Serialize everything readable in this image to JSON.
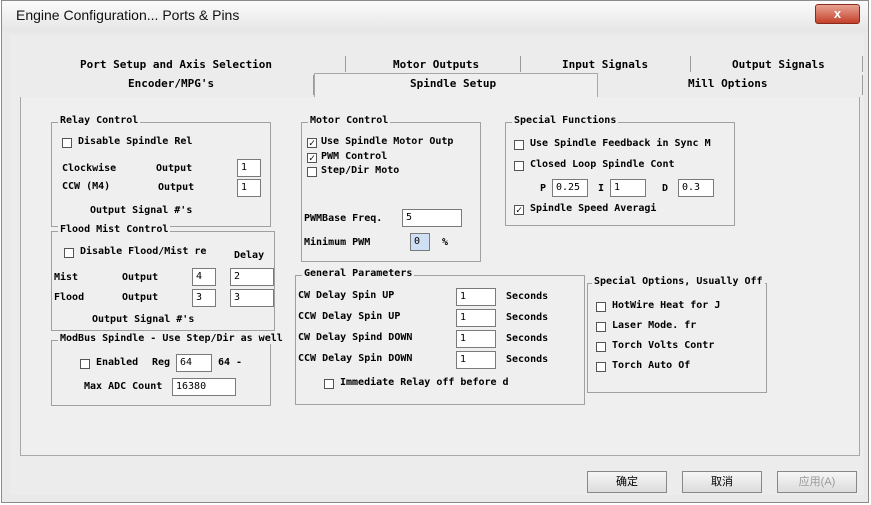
{
  "window": {
    "title": "Engine Configuration... Ports & Pins",
    "close_label": "x"
  },
  "tabs": {
    "row1": [
      "Port Setup and Axis Selection",
      "Motor Outputs",
      "Input Signals",
      "Output Signals"
    ],
    "row2": [
      "Encoder/MPG's",
      "Spindle Setup",
      "Mill Options"
    ],
    "active": "Spindle Setup"
  },
  "relay_control": {
    "title": "Relay Control",
    "disable_label": "Disable Spindle Rel",
    "disable_checked": false,
    "cw_label": "Clockwise",
    "cw_output_label": "Output",
    "cw_output_value": "1",
    "ccw_label": "CCW (M4)",
    "ccw_output_label": "Output",
    "ccw_output_value": "1",
    "footer": "Output Signal #'s"
  },
  "flood_mist": {
    "title": "Flood Mist Control",
    "disable_label": "Disable Flood/Mist re",
    "disable_checked": false,
    "delay_label": "Delay",
    "mist_label": "Mist",
    "mist_output_label": "Output",
    "mist_output_value": "4",
    "mist_delay_value": "2",
    "flood_label": "Flood",
    "flood_output_label": "Output",
    "flood_output_value": "3",
    "flood_delay_value": "3",
    "footer": "Output Signal #'s"
  },
  "modbus": {
    "title": "ModBus Spindle - Use Step/Dir as well",
    "enabled_label": "Enabled",
    "enabled_checked": false,
    "reg_label": "Reg",
    "reg_value": "64",
    "reg_suffix": "64 -",
    "max_adc_label": "Max ADC Count",
    "max_adc_value": "16380"
  },
  "motor_control": {
    "title": "Motor Control",
    "use_spindle_label": "Use Spindle Motor Outp",
    "use_spindle_checked": true,
    "pwm_label": "PWM Control",
    "pwm_checked": true,
    "stepdir_label": "Step/Dir Moto",
    "stepdir_checked": false,
    "pwm_base_label": "PWMBase Freq.",
    "pwm_base_value": "5",
    "min_pwm_label": "Minimum PWM",
    "min_pwm_value": "0",
    "min_pwm_unit": "%"
  },
  "special_functions": {
    "title": "Special Functions",
    "feedback_label": "Use Spindle Feedback in Sync M",
    "feedback_checked": false,
    "closed_loop_label": "Closed Loop Spindle Cont",
    "closed_loop_checked": false,
    "p_label": "P",
    "p_value": "0.25",
    "i_label": "I",
    "i_value": "1",
    "d_label": "D",
    "d_value": "0.3",
    "averaging_label": "Spindle Speed Averagi",
    "averaging_checked": true
  },
  "general_parameters": {
    "title": "General Parameters",
    "rows": [
      {
        "label": "CW Delay Spin UP",
        "value": "1",
        "unit": "Seconds"
      },
      {
        "label": "CCW Delay Spin UP",
        "value": "1",
        "unit": "Seconds"
      },
      {
        "label": "CW Delay Spind DOWN",
        "value": "1",
        "unit": "Seconds"
      },
      {
        "label": "CCW Delay Spin DOWN",
        "value": "1",
        "unit": "Seconds"
      }
    ],
    "immediate_label": "Immediate Relay off before d",
    "immediate_checked": false
  },
  "special_options": {
    "title": "Special Options, Usually Off",
    "items": [
      {
        "label": "HotWire Heat for J",
        "checked": false
      },
      {
        "label": "Laser Mode. fr",
        "checked": false
      },
      {
        "label": "Torch Volts Contr",
        "checked": false
      },
      {
        "label": "Torch Auto Of",
        "checked": false
      }
    ]
  },
  "buttons": {
    "ok": "确定",
    "cancel": "取消",
    "apply": "应用(A)"
  },
  "check_glyph": "✓"
}
